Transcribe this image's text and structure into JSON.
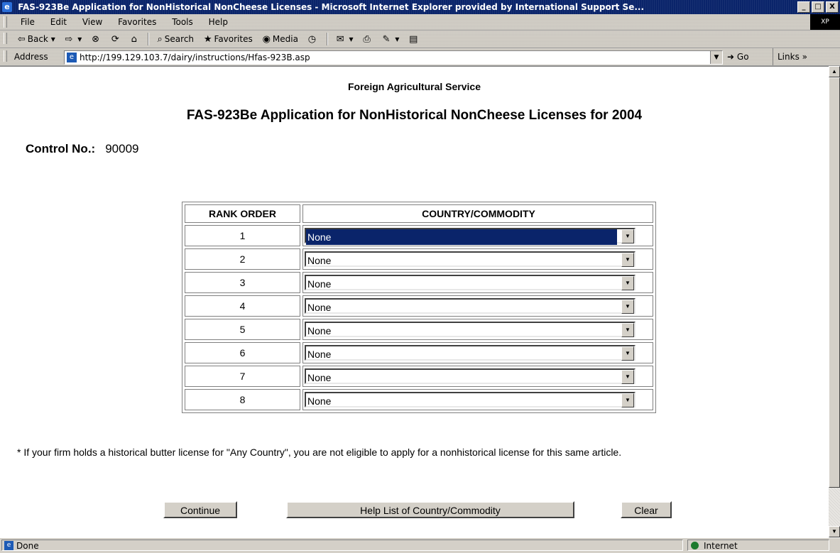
{
  "window": {
    "title": "FAS-923Be Application for NonHistorical NonCheese Licenses - Microsoft Internet Explorer provided by International Support Se...",
    "buttons": [
      "_",
      "□",
      "X"
    ]
  },
  "menu": {
    "items": [
      "File",
      "Edit",
      "View",
      "Favorites",
      "Tools",
      "Help"
    ],
    "flag_text": "XP"
  },
  "toolbar": {
    "back": "Back",
    "search": "Search",
    "favorites": "Favorites",
    "media": "Media"
  },
  "address": {
    "label": "Address",
    "url": "http://199.129.103.7/dairy/instructions/Hfas-923B.asp",
    "go": "Go",
    "links": "Links"
  },
  "page": {
    "agency": "Foreign Agricultural Service",
    "title": "FAS-923Be Application for NonHistorical NonCheese Licenses for 2004",
    "control_label": "Control No.:",
    "control_value": "90009",
    "table": {
      "headers": [
        "RANK ORDER",
        "COUNTRY/COMMODITY"
      ],
      "rows": [
        {
          "rank": "1",
          "value": "None"
        },
        {
          "rank": "2",
          "value": "None"
        },
        {
          "rank": "3",
          "value": "None"
        },
        {
          "rank": "4",
          "value": "None"
        },
        {
          "rank": "5",
          "value": "None"
        },
        {
          "rank": "6",
          "value": "None"
        },
        {
          "rank": "7",
          "value": "None"
        },
        {
          "rank": "8",
          "value": "None"
        }
      ]
    },
    "note": "* If your firm holds a historical butter license for \"Any Country\", you are not eligible to apply for a nonhistorical license for this same article.",
    "buttons": {
      "continue": "Continue",
      "help": "Help List of Country/Commodity",
      "clear": "Clear"
    }
  },
  "status": {
    "text": "Done",
    "zone": "Internet"
  }
}
